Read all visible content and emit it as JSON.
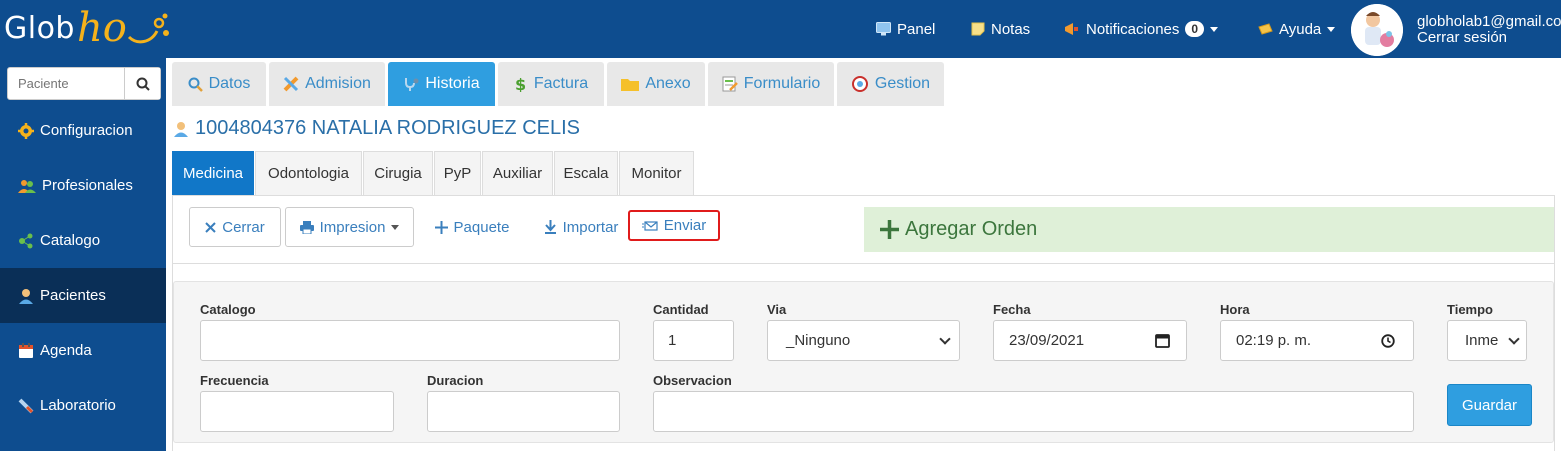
{
  "brand": {
    "text": "Glob",
    "script": "ho"
  },
  "topnav": {
    "panel": "Panel",
    "notas": "Notas",
    "notificaciones": "Notificaciones",
    "notif_count": "0",
    "ayuda": "Ayuda"
  },
  "user": {
    "email": "globholab1@gmail.co",
    "logout": "Cerrar sesión"
  },
  "sidebar": {
    "search_placeholder": "Paciente",
    "items": [
      {
        "label": "Configuracion",
        "icon": "gear-icon"
      },
      {
        "label": "Profesionales",
        "icon": "users-icon"
      },
      {
        "label": "Catalogo",
        "icon": "share-nodes-icon"
      },
      {
        "label": "Pacientes",
        "icon": "user-icon",
        "active": true
      },
      {
        "label": "Agenda",
        "icon": "calendar-icon"
      },
      {
        "label": "Laboratorio",
        "icon": "syringe-icon"
      }
    ]
  },
  "main_tabs": [
    {
      "label": "Datos",
      "icon": "search-icon"
    },
    {
      "label": "Admision",
      "icon": "pencil-icon"
    },
    {
      "label": "Historia",
      "icon": "stethoscope-icon",
      "active": true
    },
    {
      "label": "Factura",
      "icon": "dollar-icon"
    },
    {
      "label": "Anexo",
      "icon": "folder-icon"
    },
    {
      "label": "Formulario",
      "icon": "form-icon"
    },
    {
      "label": "Gestion",
      "icon": "gestion-icon"
    }
  ],
  "patient": {
    "name": "1004804376 NATALIA RODRIGUEZ CELIS"
  },
  "sub_tabs": [
    {
      "label": "Medicina",
      "active": true
    },
    {
      "label": "Odontologia"
    },
    {
      "label": "Cirugia"
    },
    {
      "label": "PyP"
    },
    {
      "label": "Auxiliar"
    },
    {
      "label": "Escala"
    },
    {
      "label": "Monitor"
    }
  ],
  "toolbar": {
    "cerrar": "Cerrar",
    "impresion": "Impresion",
    "paquete": "Paquete",
    "importar": "Importar",
    "enviar": "Enviar",
    "agregar_orden": "Agregar Orden"
  },
  "form": {
    "catalogo_label": "Catalogo",
    "catalogo_value": "",
    "cantidad_label": "Cantidad",
    "cantidad_value": "1",
    "via_label": "Via",
    "via_value": "_Ninguno",
    "fecha_label": "Fecha",
    "fecha_value": "23/09/2021",
    "hora_label": "Hora",
    "hora_value": "02:19 p. m.",
    "tiempo_label": "Tiempo",
    "tiempo_value": "Inme",
    "frecuencia_label": "Frecuencia",
    "frecuencia_value": "",
    "duracion_label": "Duracion",
    "duracion_value": "",
    "observacion_label": "Observacion",
    "observacion_value": "",
    "guardar": "Guardar"
  },
  "colors": {
    "topbar": "#0e4d8f",
    "sidebar_active": "#0a2f57",
    "tab_active": "#2f9ee0",
    "subtab_active": "#1177c8",
    "highlight": "#e01b1b",
    "add_order_bg": "#dff0d8"
  }
}
